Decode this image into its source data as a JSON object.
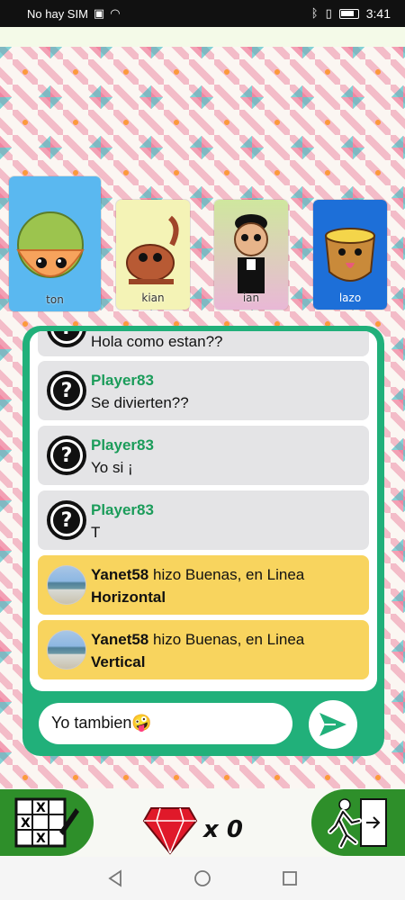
{
  "status_bar": {
    "carrier": "No hay SIM",
    "time": "3:41"
  },
  "players": [
    {
      "name": "ton",
      "bg": "#5ab8f0"
    },
    {
      "name": "kian",
      "bg": "#f4f3b6"
    },
    {
      "name": "ian",
      "bg": "#cfe79e"
    },
    {
      "name": "lazo",
      "bg": "#1d6fd8"
    }
  ],
  "chat": {
    "messages": [
      {
        "type": "user",
        "author": "",
        "text": "Hola como estan??"
      },
      {
        "type": "user",
        "author": "Player83",
        "text": "Se divierten??"
      },
      {
        "type": "user",
        "author": "Player83",
        "text": "Yo si ¡"
      },
      {
        "type": "user",
        "author": "Player83",
        "text": "T"
      },
      {
        "type": "event",
        "author": "Yanet58",
        "text": "hizo Buenas, en Linea",
        "detail": "Horizontal"
      },
      {
        "type": "event",
        "author": "Yanet58",
        "text": "hizo Buenas, en Linea",
        "detail": "Vertical"
      }
    ],
    "input_value": "Yo tambien🤪",
    "send_icon": "send-arrow-icon"
  },
  "bottom_bar": {
    "left_icon": "board-card-icon",
    "gem_count_label": "x 0",
    "right_icon": "exit-door-icon"
  },
  "colors": {
    "accent_green": "#21b07a",
    "author_green": "#1b9c5a",
    "event_yellow": "#f8d45e",
    "button_green": "#2e8f2a"
  }
}
